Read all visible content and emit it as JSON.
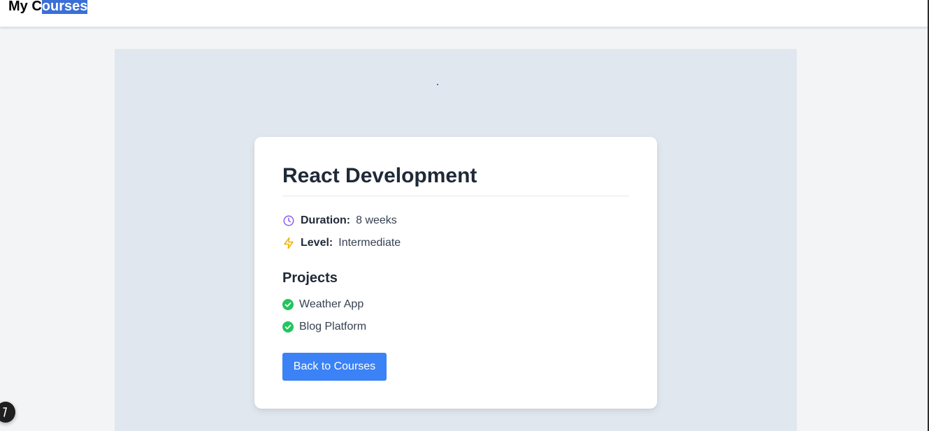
{
  "header": {
    "title_prefix": "My C",
    "title_selected": "ourses"
  },
  "course": {
    "title": "React Development",
    "duration_label": "Duration:",
    "duration_value": "8 weeks",
    "level_label": "Level:",
    "level_value": "Intermediate",
    "projects_heading": "Projects",
    "projects": [
      "Weather App",
      "Blog Platform"
    ],
    "back_label": "Back to Courses"
  },
  "icons": {
    "duration": "clock-icon",
    "level": "lightning-icon",
    "project": "check-circle-icon",
    "badge": "dev-tools-icon"
  },
  "colors": {
    "accent": "#3b82f6",
    "clock": "#8b5cf6",
    "lightning": "#eab308",
    "check": "#22c55e",
    "selection": "#3a6fd8"
  }
}
